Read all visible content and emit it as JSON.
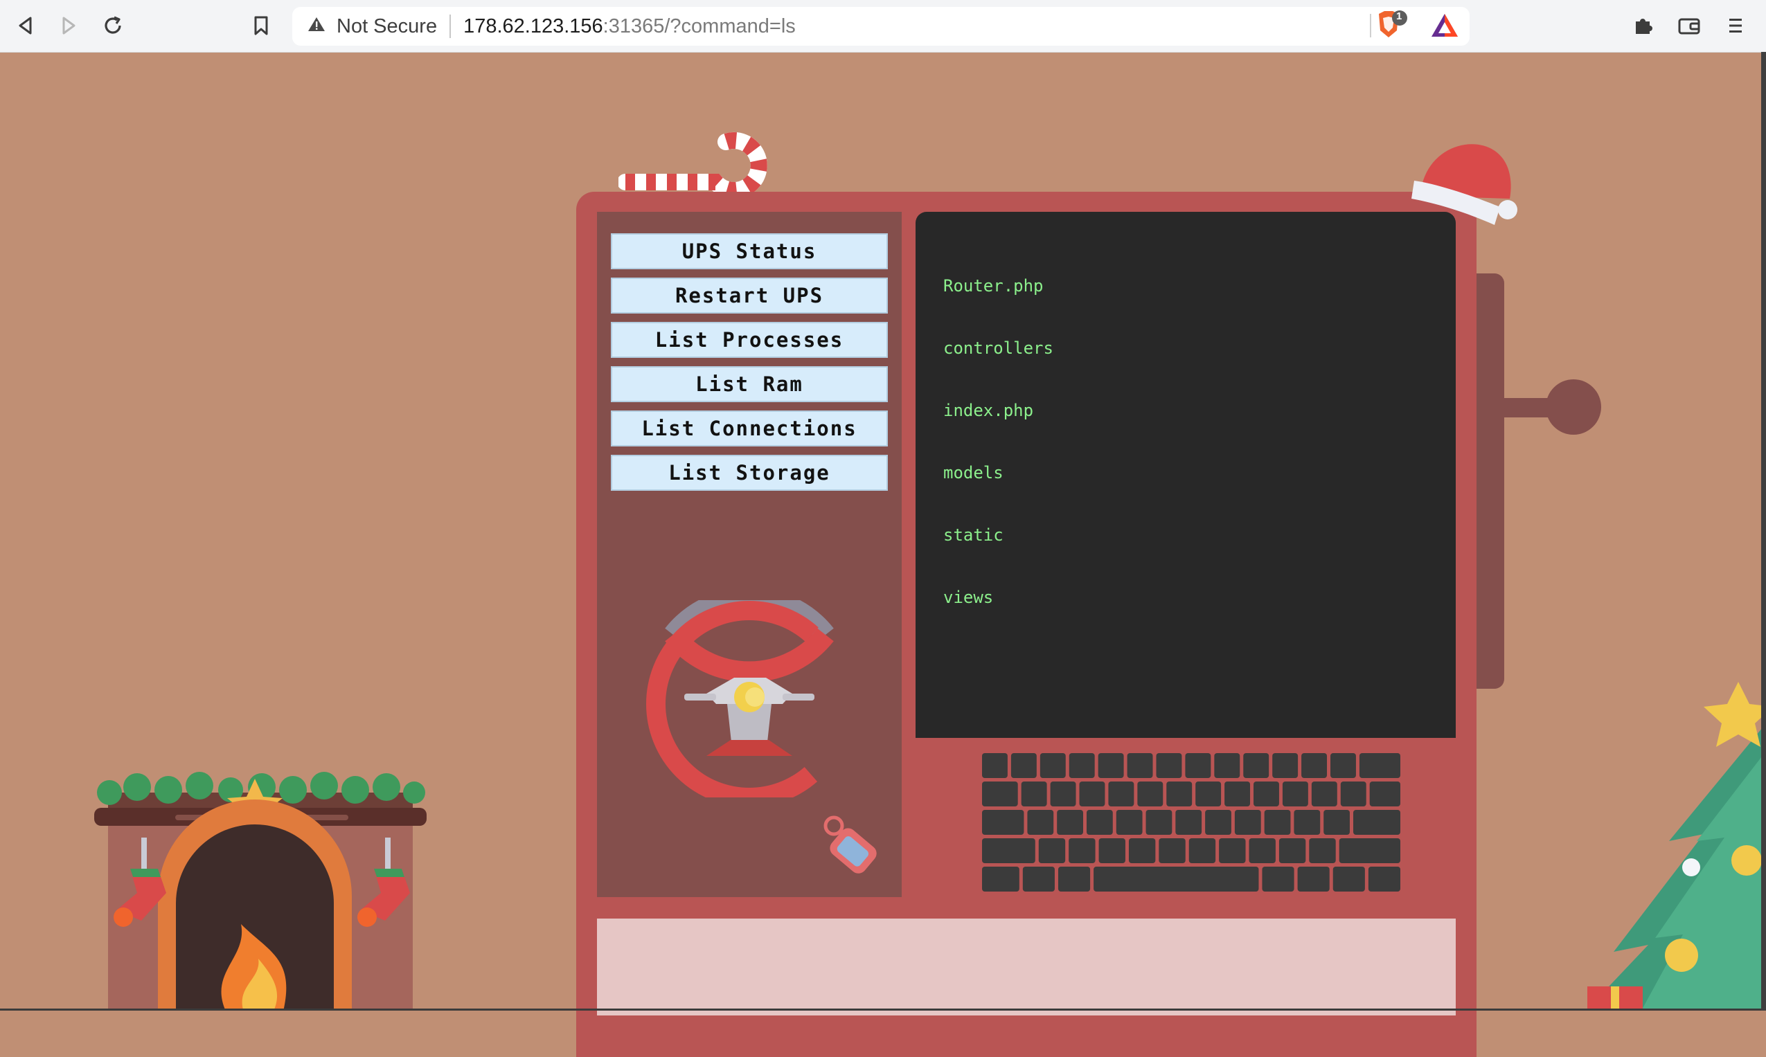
{
  "browser": {
    "back_icon": "back-arrow-icon",
    "forward_icon": "forward-arrow-icon",
    "reload_icon": "reload-icon",
    "bookmark_icon": "bookmark-icon",
    "security_label": "Not Secure",
    "url_host": "178.62.123.156",
    "url_rest": ":31365/?command=ls",
    "shield_badge": "1",
    "extensions_icon": "puzzle-icon",
    "wallet_icon": "wallet-icon",
    "menu_icon": "menu-icon"
  },
  "panel": {
    "buttons": [
      {
        "label": "UPS Status"
      },
      {
        "label": "Restart UPS"
      },
      {
        "label": "List Processes"
      },
      {
        "label": "List Ram"
      },
      {
        "label": "List Connections"
      },
      {
        "label": "List Storage"
      }
    ]
  },
  "terminal": {
    "lines": [
      "Router.php",
      "controllers",
      "index.php",
      "models",
      "static",
      "views"
    ]
  },
  "colors": {
    "background": "#c08f74",
    "machine": "#b95554",
    "panel": "#844f4c",
    "terminal": "#282828",
    "terminal_text": "#8cf08c",
    "button": "#d7ecfb",
    "paper": "#e6c6c5"
  }
}
